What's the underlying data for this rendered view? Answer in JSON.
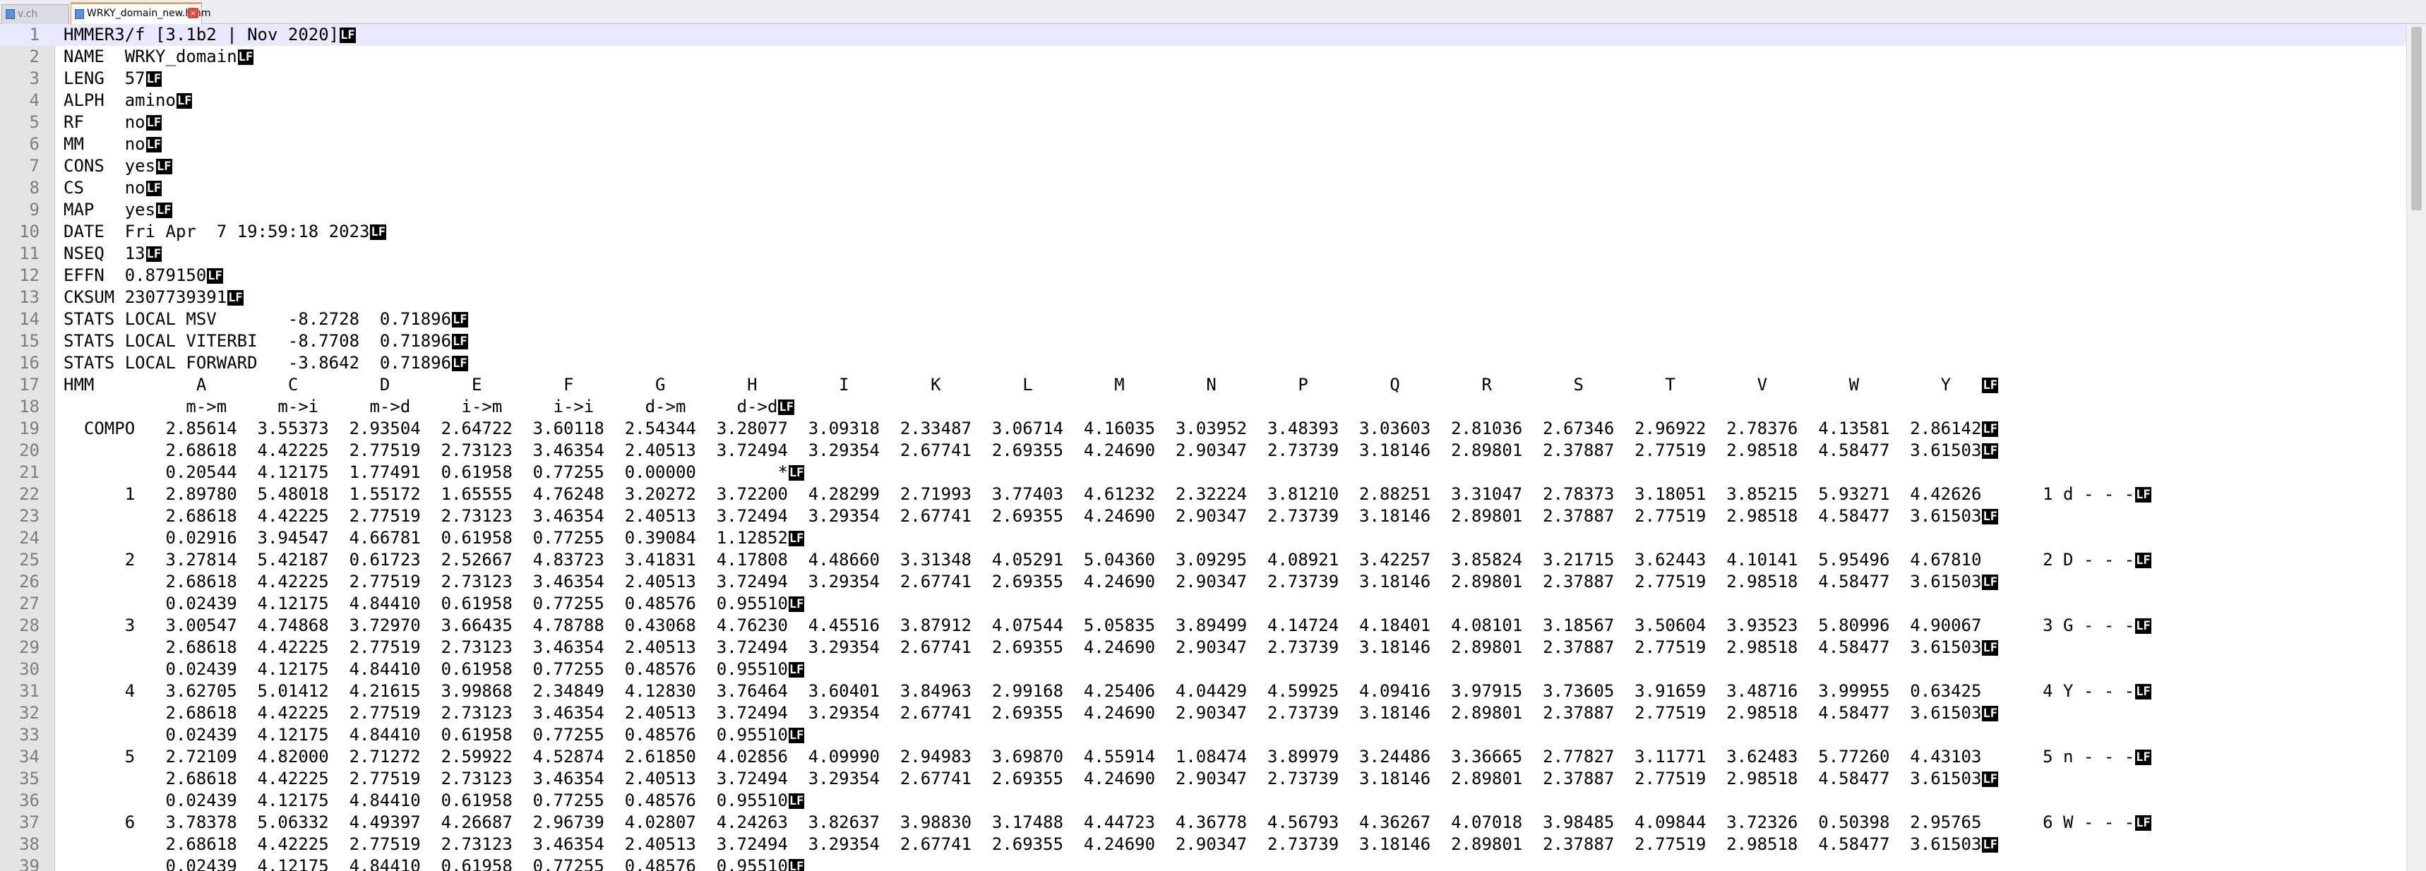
{
  "tabs": [
    {
      "label": "v.ch",
      "icon": "file-icon",
      "active": false
    },
    {
      "label": "WRKY_domain_new.hmm",
      "icon": "file-icon",
      "active": true,
      "close": "×"
    }
  ],
  "eol_marker": "LF",
  "lines": [
    {
      "n": "1",
      "text": "HMMER3/f [3.1b2 | Nov 2020]"
    },
    {
      "n": "2",
      "text": "NAME  WRKY_domain"
    },
    {
      "n": "3",
      "text": "LENG  57"
    },
    {
      "n": "4",
      "text": "ALPH  amino"
    },
    {
      "n": "5",
      "text": "RF    no"
    },
    {
      "n": "6",
      "text": "MM    no"
    },
    {
      "n": "7",
      "text": "CONS  yes"
    },
    {
      "n": "8",
      "text": "CS    no"
    },
    {
      "n": "9",
      "text": "MAP   yes"
    },
    {
      "n": "10",
      "text": "DATE  Fri Apr  7 19:59:18 2023"
    },
    {
      "n": "11",
      "text": "NSEQ  13"
    },
    {
      "n": "12",
      "text": "EFFN  0.879150"
    },
    {
      "n": "13",
      "text": "CKSUM 2307739391"
    },
    {
      "n": "14",
      "text": "STATS LOCAL MSV       -8.2728  0.71896"
    },
    {
      "n": "15",
      "text": "STATS LOCAL VITERBI   -8.7708  0.71896"
    },
    {
      "n": "16",
      "text": "STATS LOCAL FORWARD   -3.8642  0.71896"
    },
    {
      "n": "17",
      "text": "HMM          A        C        D        E        F        G        H        I        K        L        M        N        P        Q        R        S        T        V        W        Y   "
    },
    {
      "n": "18",
      "text": "            m->m     m->i     m->d     i->m     i->i     d->m     d->d"
    },
    {
      "n": "19",
      "text": "  COMPO   2.85614  3.55373  2.93504  2.64722  3.60118  2.54344  3.28077  3.09318  2.33487  3.06714  4.16035  3.03952  3.48393  3.03603  2.81036  2.67346  2.96922  2.78376  4.13581  2.86142"
    },
    {
      "n": "20",
      "text": "          2.68618  4.42225  2.77519  2.73123  3.46354  2.40513  3.72494  3.29354  2.67741  2.69355  4.24690  2.90347  2.73739  3.18146  2.89801  2.37887  2.77519  2.98518  4.58477  3.61503"
    },
    {
      "n": "21",
      "text": "          0.20544  4.12175  1.77491  0.61958  0.77255  0.00000        *"
    },
    {
      "n": "22",
      "text": "      1   2.89780  5.48018  1.55172  1.65555  4.76248  3.20272  3.72200  4.28299  2.71993  3.77403  4.61232  2.32224  3.81210  2.88251  3.31047  2.78373  3.18051  3.85215  5.93271  4.42626      1 d - - -"
    },
    {
      "n": "23",
      "text": "          2.68618  4.42225  2.77519  2.73123  3.46354  2.40513  3.72494  3.29354  2.67741  2.69355  4.24690  2.90347  2.73739  3.18146  2.89801  2.37887  2.77519  2.98518  4.58477  3.61503"
    },
    {
      "n": "24",
      "text": "          0.02916  3.94547  4.66781  0.61958  0.77255  0.39084  1.12852"
    },
    {
      "n": "25",
      "text": "      2   3.27814  5.42187  0.61723  2.52667  4.83723  3.41831  4.17808  4.48660  3.31348  4.05291  5.04360  3.09295  4.08921  3.42257  3.85824  3.21715  3.62443  4.10141  5.95496  4.67810      2 D - - -"
    },
    {
      "n": "26",
      "text": "          2.68618  4.42225  2.77519  2.73123  3.46354  2.40513  3.72494  3.29354  2.67741  2.69355  4.24690  2.90347  2.73739  3.18146  2.89801  2.37887  2.77519  2.98518  4.58477  3.61503"
    },
    {
      "n": "27",
      "text": "          0.02439  4.12175  4.84410  0.61958  0.77255  0.48576  0.95510"
    },
    {
      "n": "28",
      "text": "      3   3.00547  4.74868  3.72970  3.66435  4.78788  0.43068  4.76230  4.45516  3.87912  4.07544  5.05835  3.89499  4.14724  4.18401  4.08101  3.18567  3.50604  3.93523  5.80996  4.90067      3 G - - -"
    },
    {
      "n": "29",
      "text": "          2.68618  4.42225  2.77519  2.73123  3.46354  2.40513  3.72494  3.29354  2.67741  2.69355  4.24690  2.90347  2.73739  3.18146  2.89801  2.37887  2.77519  2.98518  4.58477  3.61503"
    },
    {
      "n": "30",
      "text": "          0.02439  4.12175  4.84410  0.61958  0.77255  0.48576  0.95510"
    },
    {
      "n": "31",
      "text": "      4   3.62705  5.01412  4.21615  3.99868  2.34849  4.12830  3.76464  3.60401  3.84963  2.99168  4.25406  4.04429  4.59925  4.09416  3.97915  3.73605  3.91659  3.48716  3.99955  0.63425      4 Y - - -"
    },
    {
      "n": "32",
      "text": "          2.68618  4.42225  2.77519  2.73123  3.46354  2.40513  3.72494  3.29354  2.67741  2.69355  4.24690  2.90347  2.73739  3.18146  2.89801  2.37887  2.77519  2.98518  4.58477  3.61503"
    },
    {
      "n": "33",
      "text": "          0.02439  4.12175  4.84410  0.61958  0.77255  0.48576  0.95510"
    },
    {
      "n": "34",
      "text": "      5   2.72109  4.82000  2.71272  2.59922  4.52874  2.61850  4.02856  4.09990  2.94983  3.69870  4.55914  1.08474  3.89979  3.24486  3.36665  2.77827  3.11771  3.62483  5.77260  4.43103      5 n - - -"
    },
    {
      "n": "35",
      "text": "          2.68618  4.42225  2.77519  2.73123  3.46354  2.40513  3.72494  3.29354  2.67741  2.69355  4.24690  2.90347  2.73739  3.18146  2.89801  2.37887  2.77519  2.98518  4.58477  3.61503"
    },
    {
      "n": "36",
      "text": "          0.02439  4.12175  4.84410  0.61958  0.77255  0.48576  0.95510"
    },
    {
      "n": "37",
      "text": "      6   3.78378  5.06332  4.49397  4.26687  2.96739  4.02807  4.24263  3.82637  3.98830  3.17488  4.44723  4.36778  4.56793  4.36267  4.07018  3.98485  4.09844  3.72326  0.50398  2.95765      6 W - - -"
    },
    {
      "n": "38",
      "text": "          2.68618  4.42225  2.77519  2.73123  3.46354  2.40513  3.72494  3.29354  2.67741  2.69355  4.24690  2.90347  2.73739  3.18146  2.89801  2.37887  2.77519  2.98518  4.58477  3.61503"
    },
    {
      "n": "39",
      "text": "          0.02439  4.12175  4.84410  0.61958  0.77255  0.48576  0.95510"
    }
  ]
}
